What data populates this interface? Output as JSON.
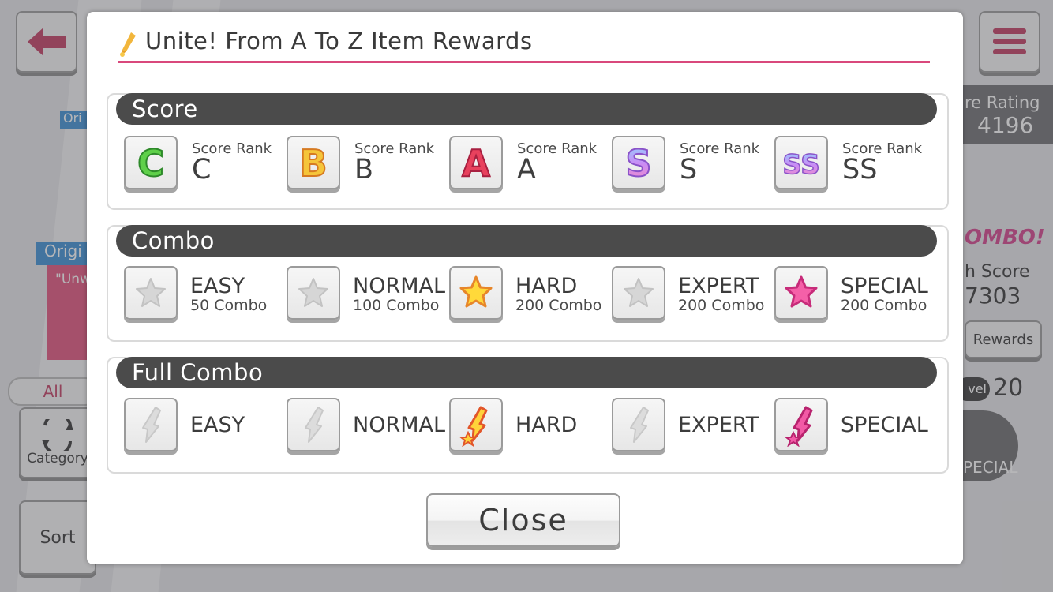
{
  "background": {
    "category_label": "All",
    "category_button": "Category",
    "sort_button": "Sort",
    "rating_label": "re Rating",
    "rating_value": "4196",
    "combo_logo": "OMBO!",
    "high_score_label": "h Score",
    "high_score_value": "7303",
    "rewards_button": "Rewards",
    "level_label": "vel",
    "level_value": "20",
    "difficulty_label": "PECIAL",
    "song_tag_1": "Ori",
    "song_tag_2": "Origi",
    "song_snippet": "\"Unw"
  },
  "modal": {
    "title": "Unite! From A To Z Item Rewards",
    "close_label": "Close",
    "accent_color": "#d9487c"
  },
  "score": {
    "header": "Score",
    "items": [
      {
        "label": "Score Rank",
        "value": "C",
        "icon": "rank-c-icon"
      },
      {
        "label": "Score Rank",
        "value": "B",
        "icon": "rank-b-icon"
      },
      {
        "label": "Score Rank",
        "value": "A",
        "icon": "rank-a-icon"
      },
      {
        "label": "Score Rank",
        "value": "S",
        "icon": "rank-s-icon"
      },
      {
        "label": "Score Rank",
        "value": "SS",
        "icon": "rank-ss-icon"
      }
    ]
  },
  "combo": {
    "header": "Combo",
    "items": [
      {
        "name": "EASY",
        "sub": "50 Combo",
        "icon": "star-gray-icon"
      },
      {
        "name": "NORMAL",
        "sub": "100 Combo",
        "icon": "star-gray-icon"
      },
      {
        "name": "HARD",
        "sub": "200 Combo",
        "icon": "star-gold-icon"
      },
      {
        "name": "EXPERT",
        "sub": "200 Combo",
        "icon": "star-gray-icon"
      },
      {
        "name": "SPECIAL",
        "sub": "200 Combo",
        "icon": "star-pink-icon"
      }
    ]
  },
  "full_combo": {
    "header": "Full Combo",
    "items": [
      {
        "name": "EASY",
        "icon": "bolt-gray-icon"
      },
      {
        "name": "NORMAL",
        "icon": "bolt-gray-icon"
      },
      {
        "name": "HARD",
        "icon": "bolt-gold-icon"
      },
      {
        "name": "EXPERT",
        "icon": "bolt-gray-icon"
      },
      {
        "name": "SPECIAL",
        "icon": "bolt-pink-icon"
      }
    ]
  }
}
